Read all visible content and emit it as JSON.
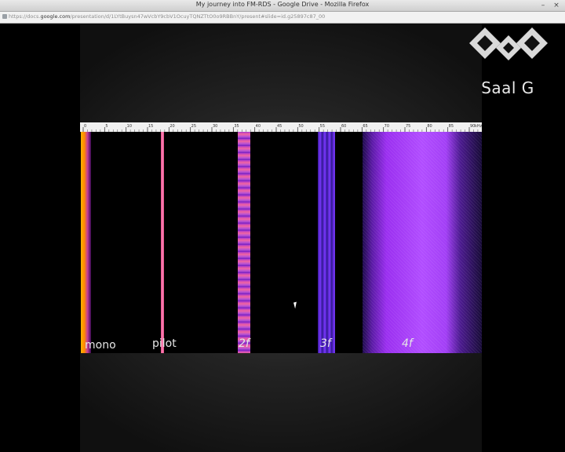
{
  "window": {
    "title": "My journey into FM-RDS - Google Drive - Mozilla Firefox",
    "controls": {
      "minimize": "–",
      "close": "×"
    }
  },
  "urlbar": {
    "url_prefix": "https://docs.",
    "url_domain": "google.com",
    "url_rest": "/presentation/d/1LYtBuysn47wVcbY9cbV1OcuyTQNZTtO0o9RBBnY/present#slide=id.g25897c87_00"
  },
  "logo": {
    "text": "Saal G",
    "icon": "ccc-diamond-logo"
  },
  "ruler": {
    "ticks": [
      "0",
      "5",
      "10",
      "15",
      "20",
      "25",
      "30",
      "35",
      "40",
      "45",
      "50",
      "55",
      "60",
      "65",
      "70",
      "75",
      "80",
      "85",
      "90",
      "kHz"
    ]
  },
  "spectrogram": {
    "labels": {
      "mono": "mono",
      "pilot": "pilot",
      "f2": "2f",
      "f3": "3f",
      "f4": "4f"
    },
    "colors": {
      "mono": "#ff9a00",
      "pilot": "#ff6fa6",
      "harmonics": "#9b3cff"
    }
  }
}
